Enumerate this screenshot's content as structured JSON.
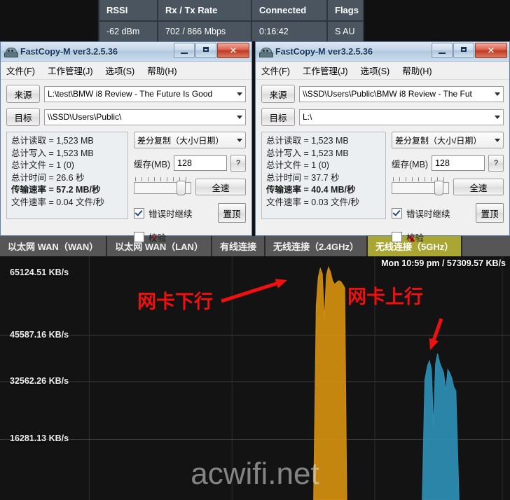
{
  "wifi_table": {
    "headers": [
      "RSSI",
      "Rx / Tx Rate",
      "Connected",
      "Flags"
    ],
    "row": [
      "-62 dBm",
      "702 / 866 Mbps",
      "0:16:42",
      "S AU"
    ]
  },
  "fastcopy_left": {
    "title": "FastCopy-M ver3.2.5.36",
    "app_icon": "fastcopy-icon",
    "menu": [
      "文件(F)",
      "工作管理(J)",
      "选项(S)",
      "帮助(H)"
    ],
    "source_label": "来源",
    "source_value": "L:\\test\\BMW i8 Review - The Future Is Good",
    "dest_label": "目标",
    "dest_value": "\\\\SSD\\Users\\Public\\",
    "stats": [
      "总计读取 = 1,523 MB",
      "总计写入 = 1,523 MB",
      "总计文件 = 1 (0)",
      "总计时间 = 26.6 秒",
      "传输速率 = 57.2 MB/秒",
      "文件速率 = 0.04 文件/秒"
    ],
    "mode_value": "差分复制（大小/日期）",
    "buffer_label": "缓存(MB)",
    "buffer_value": "128",
    "help_btn": "?",
    "fullspeed_btn": "全速",
    "continue_on_error_label": "错误时继续",
    "continue_on_error_checked": true,
    "verify_label": "校验",
    "verify_checked": false,
    "topmost_btn": "置顶",
    "window_controls": {
      "minimize": "minimize-icon",
      "maximize": "maximize-icon",
      "close": "✕"
    }
  },
  "fastcopy_right": {
    "title": "FastCopy-M ver3.2.5.36",
    "app_icon": "fastcopy-icon",
    "menu": [
      "文件(F)",
      "工作管理(J)",
      "选项(S)",
      "帮助(H)"
    ],
    "source_label": "来源",
    "source_value": "\\\\SSD\\Users\\Public\\BMW i8 Review - The Fut",
    "dest_label": "目标",
    "dest_value": "L:\\",
    "stats": [
      "总计读取 = 1,523 MB",
      "总计写入 = 1,523 MB",
      "总计文件 = 1 (0)",
      "总计时间 = 37.7 秒",
      "传输速率 = 40.4 MB/秒",
      "文件速率 = 0.03 文件/秒"
    ],
    "mode_value": "差分复制（大小/日期）",
    "buffer_label": "缓存(MB)",
    "buffer_value": "128",
    "help_btn": "?",
    "fullspeed_btn": "全速",
    "continue_on_error_label": "错误时继续",
    "continue_on_error_checked": true,
    "verify_label": "校验",
    "verify_checked": false,
    "topmost_btn": "置顶",
    "window_controls": {
      "minimize": "minimize-icon",
      "maximize": "maximize-icon",
      "close": "✕"
    }
  },
  "netmon": {
    "tabs": [
      {
        "label": "以太网 WAN（WAN）",
        "active": false
      },
      {
        "label": "以太网 WAN（LAN）",
        "active": false
      },
      {
        "label": "有线连接",
        "active": false
      },
      {
        "label": "无线连接（2.4GHz）",
        "active": false
      },
      {
        "label": "无线连接（5GHz）",
        "active": true
      }
    ],
    "status_right": "Mon 10:59 pm / 57309.57 KB/s",
    "watermark": "acwifi.net",
    "annotations": [
      {
        "name": "download-annotation",
        "text": "网卡下行",
        "color": "#f01010"
      },
      {
        "name": "upload-annotation",
        "text": "网卡上行",
        "color": "#f01010"
      }
    ]
  },
  "chart_data": {
    "type": "area",
    "title": "无线连接（5GHz）",
    "xlabel": "",
    "ylabel": "KB/s",
    "ylim": [
      0,
      65124.51
    ],
    "grid": true,
    "legend_position": "none",
    "ytick_labels": [
      "65124.51 KB/s",
      "45587.16 KB/s",
      "32562.26 KB/s",
      "16281.13 KB/s"
    ],
    "ytick_values": [
      65124.51,
      45587.16,
      32562.26,
      16281.13
    ],
    "current_reading": "57309.57 KB/s",
    "timestamp": "Mon 10:59 pm",
    "colors": {
      "download": "#d4900f",
      "upload": "#2c8fb5",
      "background": "#131313",
      "grid": "#3a3a3a",
      "active_tab": "#a9a634"
    },
    "series": [
      {
        "name": "网卡下行",
        "color": "#d4900f",
        "x": [
          0.615,
          0.62,
          0.624,
          0.628,
          0.632,
          0.636,
          0.64,
          0.644,
          0.648,
          0.652,
          0.656,
          0.66,
          0.664,
          0.668,
          0.672,
          0.676,
          0.68
        ],
        "values": [
          0,
          54000,
          62000,
          64500,
          63000,
          50000,
          62500,
          64800,
          63500,
          61000,
          60000,
          60500,
          61000,
          60800,
          60000,
          59000,
          0
        ]
      },
      {
        "name": "网卡上行",
        "color": "#2c8fb5",
        "x": [
          0.828,
          0.833,
          0.838,
          0.842,
          0.846,
          0.85,
          0.854,
          0.858,
          0.862,
          0.866,
          0.87,
          0.874,
          0.878,
          0.882,
          0.886,
          0.89,
          0.894,
          0.9
        ],
        "values": [
          0,
          33000,
          37000,
          38500,
          36000,
          20000,
          37500,
          40500,
          38000,
          36500,
          35000,
          30000,
          36000,
          35000,
          33500,
          31000,
          30000,
          0
        ]
      }
    ]
  }
}
